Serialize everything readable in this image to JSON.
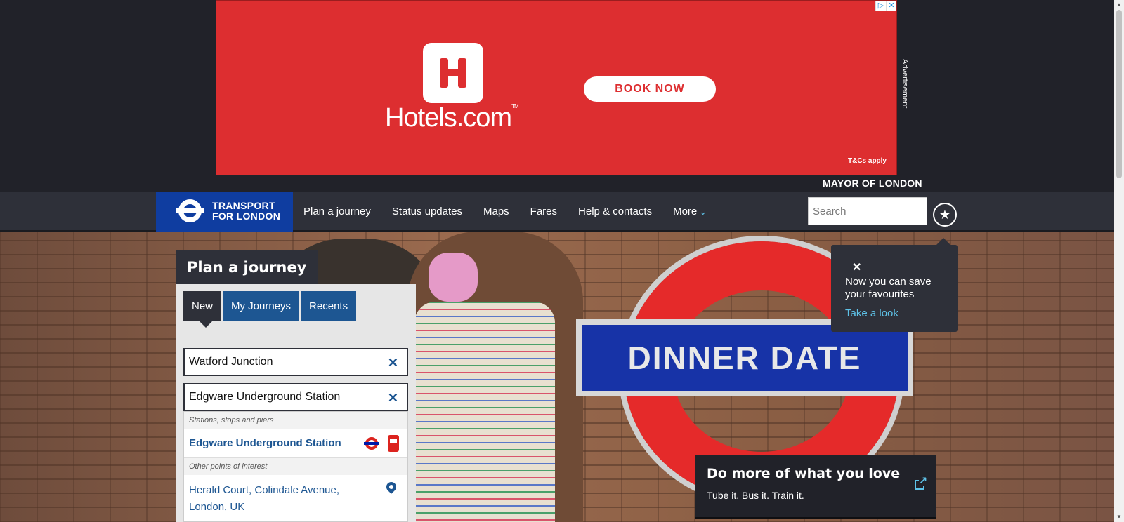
{
  "ad": {
    "brand": "Hotels.com",
    "cta": "BOOK NOW",
    "terms": "T&Cs apply",
    "label": "Advertisement",
    "brand_color": "#dd2e30"
  },
  "header": {
    "mayor": "MAYOR OF LONDON",
    "logo_line1": "TRANSPORT",
    "logo_line2": "FOR LONDON",
    "nav": [
      "Plan a journey",
      "Status updates",
      "Maps",
      "Fares",
      "Help & contacts",
      "More"
    ],
    "search_placeholder": "Search",
    "favourites_icon": "star-icon"
  },
  "hero": {
    "sign_text": "DINNER DATE"
  },
  "journey": {
    "title": "Plan a journey",
    "tabs": [
      "New",
      "My Journeys",
      "Recents"
    ],
    "from": "Watford Junction",
    "to": "Edgware Underground Station",
    "suggestions": {
      "group1_header": "Stations, stops and piers",
      "group1_item": "Edgware Underground Station",
      "group2_header": "Other points of interest",
      "group2_item": "Herald Court, Colindale Avenue, London, UK"
    }
  },
  "tooltip": {
    "close": "✕",
    "message": "Now you can save your favourites",
    "link": "Take a look"
  },
  "promo": {
    "title": "Do more of what you love",
    "subtitle": "Tube it. Bus it. Train it."
  },
  "colors": {
    "tfl_blue": "#0f3da0",
    "nav_dark": "#2e3039",
    "link_blue": "#1d5692",
    "accent_cyan": "#5ec2e8"
  }
}
